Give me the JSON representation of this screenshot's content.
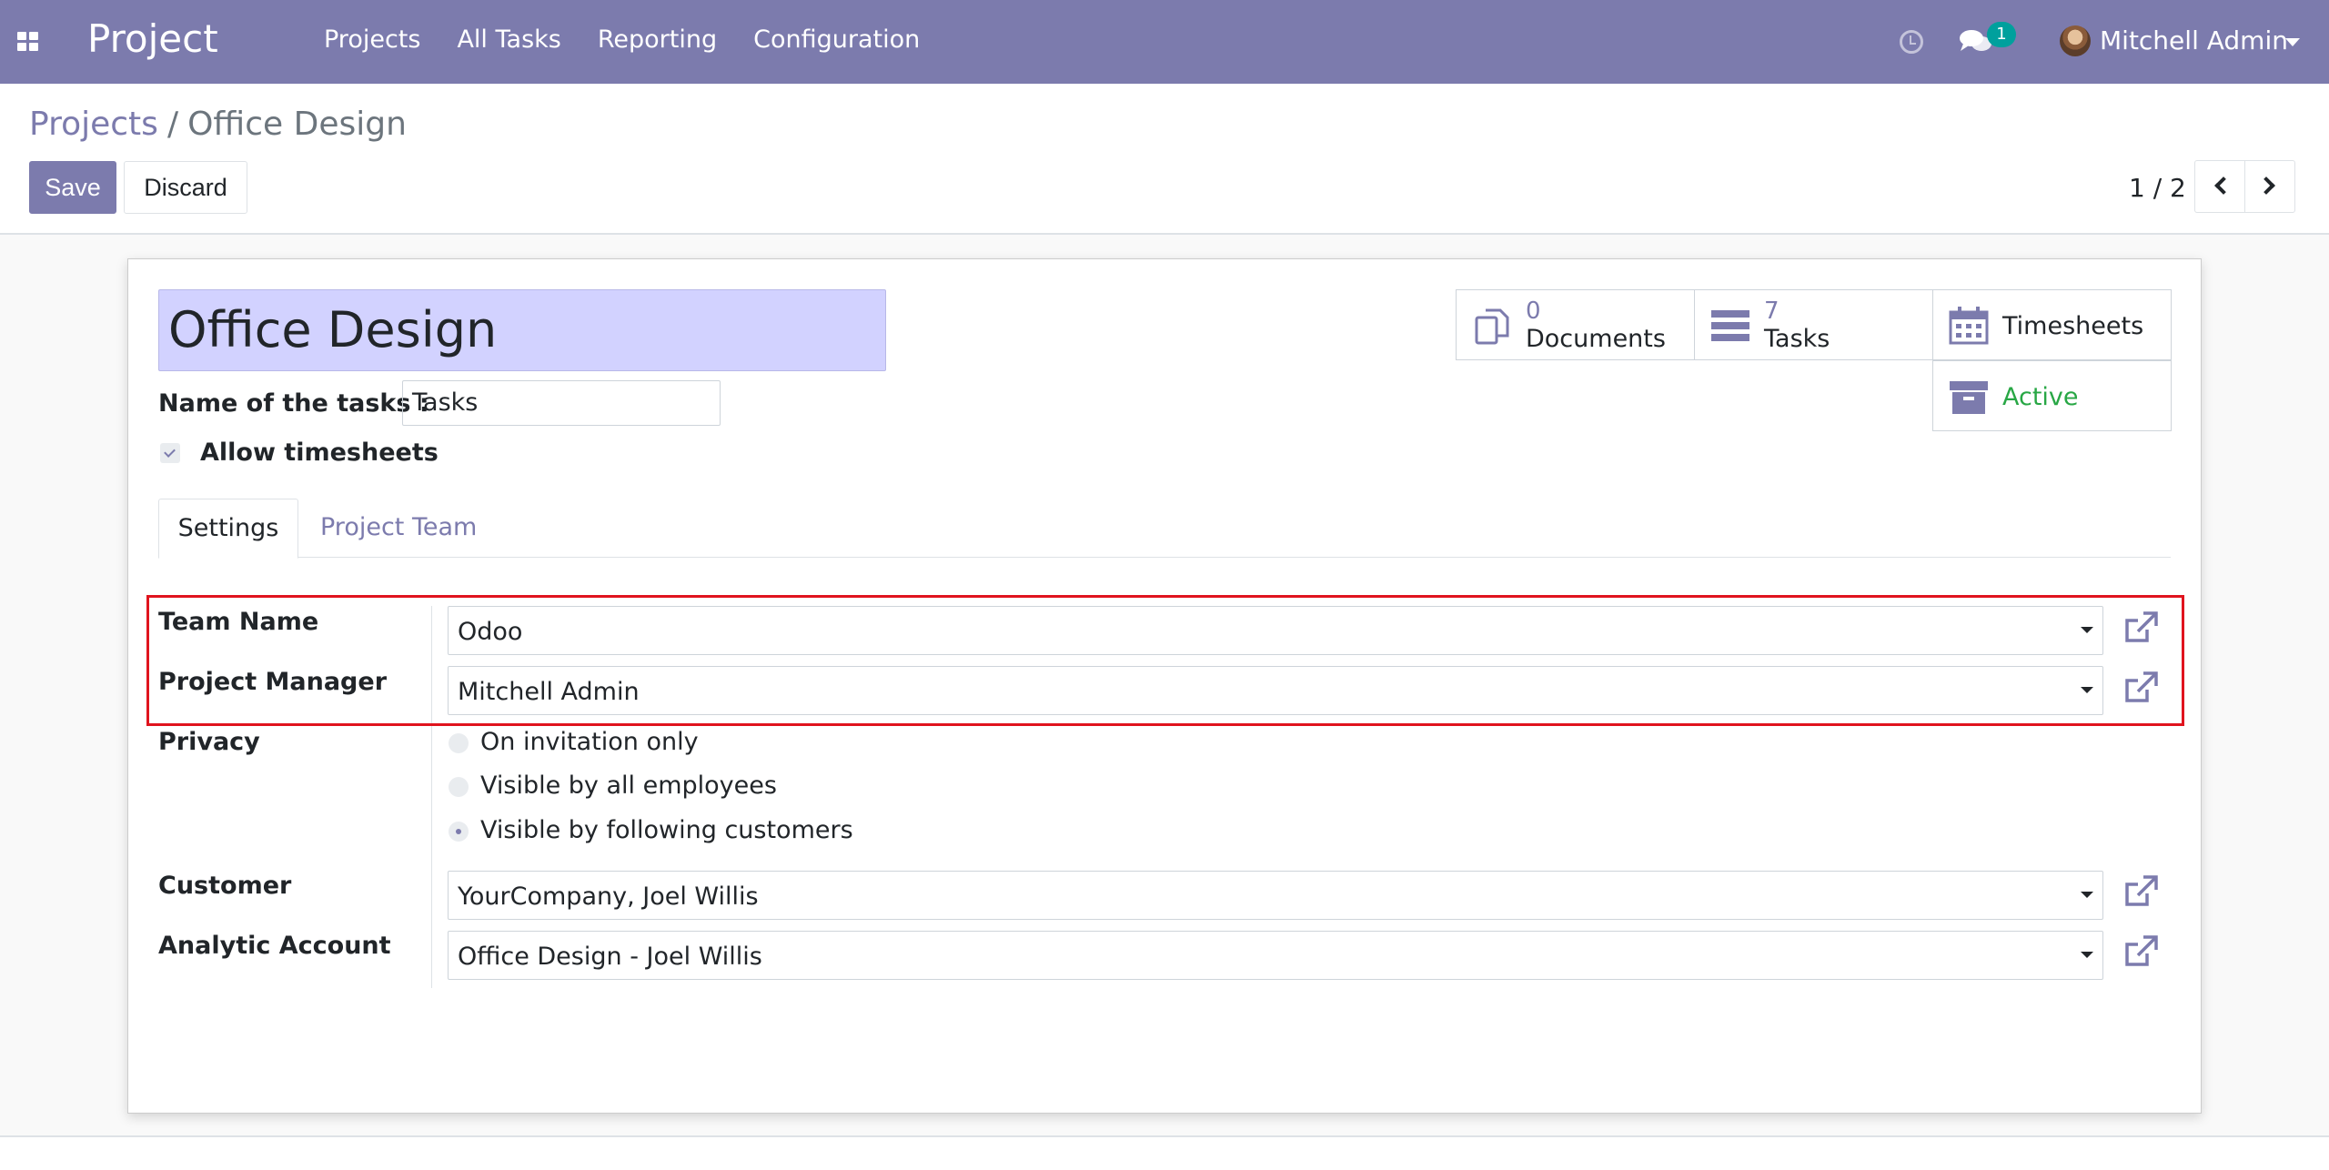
{
  "navbar": {
    "app_name": "Project",
    "menu": [
      "Projects",
      "All Tasks",
      "Reporting",
      "Configuration"
    ],
    "chat_count": "1",
    "user_name": "Mitchell Admin",
    "icons": [
      "apps-icon",
      "clock-icon",
      "chat-icon",
      "caret-down-icon"
    ],
    "color": "#7c7bad"
  },
  "breadcrumb": {
    "parent": "Projects",
    "separator": "/",
    "current": "Office Design"
  },
  "toolbar": {
    "save_label": "Save",
    "discard_label": "Discard"
  },
  "pager": {
    "value": "1 / 2"
  },
  "form": {
    "name": "Office Design",
    "tasks_label": "Name of the tasks :",
    "tasks_value": "Tasks",
    "allow_timesheets_label": "Allow timesheets",
    "allow_timesheets_checked": true
  },
  "stats": {
    "documents": {
      "count": "0",
      "label": "Documents"
    },
    "tasks": {
      "count": "7",
      "label": "Tasks"
    },
    "timesheets": {
      "label": "Timesheets"
    },
    "active": {
      "label": "Active",
      "color": "#28a745"
    }
  },
  "tabs": {
    "settings": "Settings",
    "team": "Project Team"
  },
  "fields": {
    "team_name": {
      "label": "Team Name",
      "value": "Odoo"
    },
    "project_manager": {
      "label": "Project Manager",
      "value": "Mitchell Admin"
    },
    "privacy": {
      "label": "Privacy",
      "options": [
        "On invitation only",
        "Visible by all employees",
        "Visible by following customers"
      ],
      "selected": "Visible by following customers"
    },
    "customer": {
      "label": "Customer",
      "value": "YourCompany, Joel Willis"
    },
    "analytic_account": {
      "label": "Analytic Account",
      "value": "Office Design - Joel Willis"
    }
  },
  "highlight_color": "#e0141e"
}
